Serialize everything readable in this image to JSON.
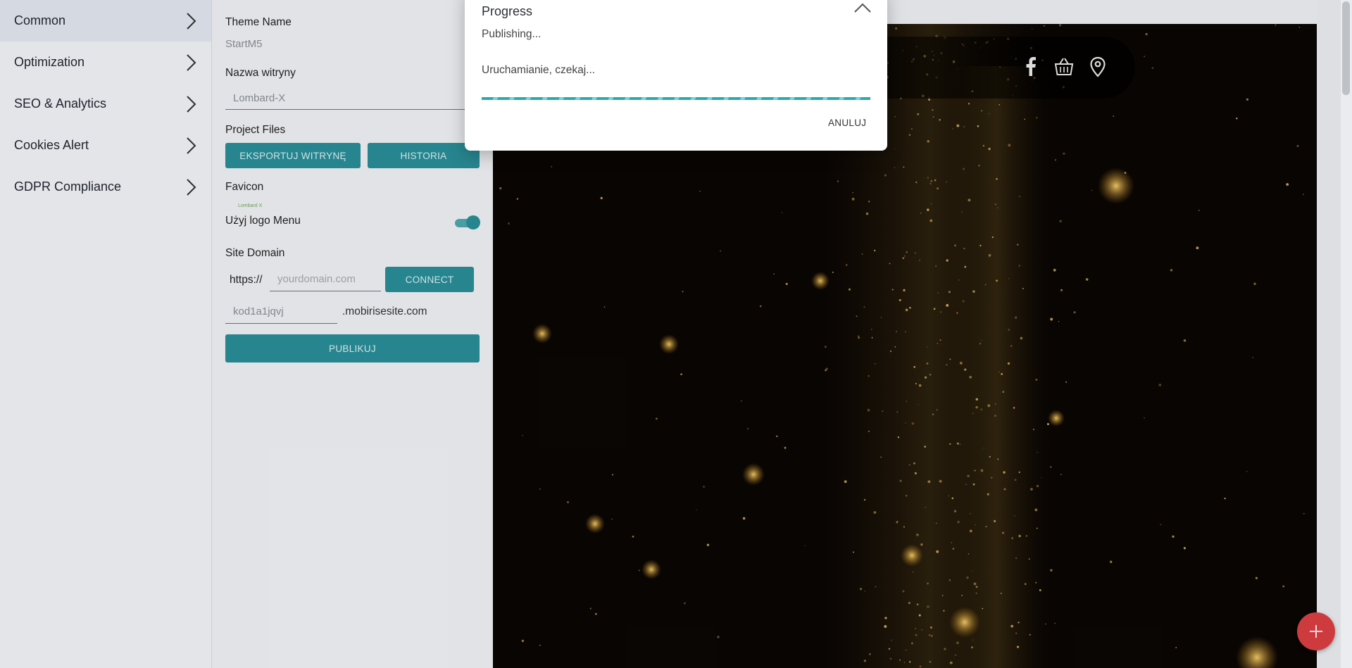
{
  "menu": {
    "items": [
      {
        "label": "Common",
        "active": true
      },
      {
        "label": "Optimization"
      },
      {
        "label": "SEO & Analytics"
      },
      {
        "label": "Cookies Alert"
      },
      {
        "label": "GDPR Compliance"
      }
    ]
  },
  "panel": {
    "theme_name_label": "Theme Name",
    "theme_name_value": "StartM5",
    "site_name_label": "Nazwa witryny",
    "site_name_value": "Lombard-X",
    "project_files_label": "Project Files",
    "export_button": "EKSPORTUJ WITRYNĘ",
    "history_button": "HISTORIA",
    "favicon_label": "Favicon",
    "favicon_logo_text": "Lombard X",
    "use_logo_label": "Użyj logo Menu",
    "use_logo_on": true,
    "site_domain_label": "Site Domain",
    "https_prefix": "https://",
    "domain_placeholder": "yourdomain.com",
    "connect_button": "CONNECT",
    "subdomain_value": "kod1a1jqvj",
    "subdomain_suffix": ".mobirisesite.com",
    "publish_button": "PUBLIKUJ"
  },
  "preview": {
    "nav_icons": [
      "facebook-icon",
      "basket-icon",
      "location-pin-icon"
    ]
  },
  "dialog": {
    "title": "Progress",
    "status": "Publishing...",
    "message": "Uruchamianie, czekaj...",
    "progress_percent": 100,
    "cancel_label": "ANULUJ"
  },
  "colors": {
    "accent": "#2a8d97",
    "progress": "#2ea8ae",
    "fab": "#ce3b3f"
  }
}
